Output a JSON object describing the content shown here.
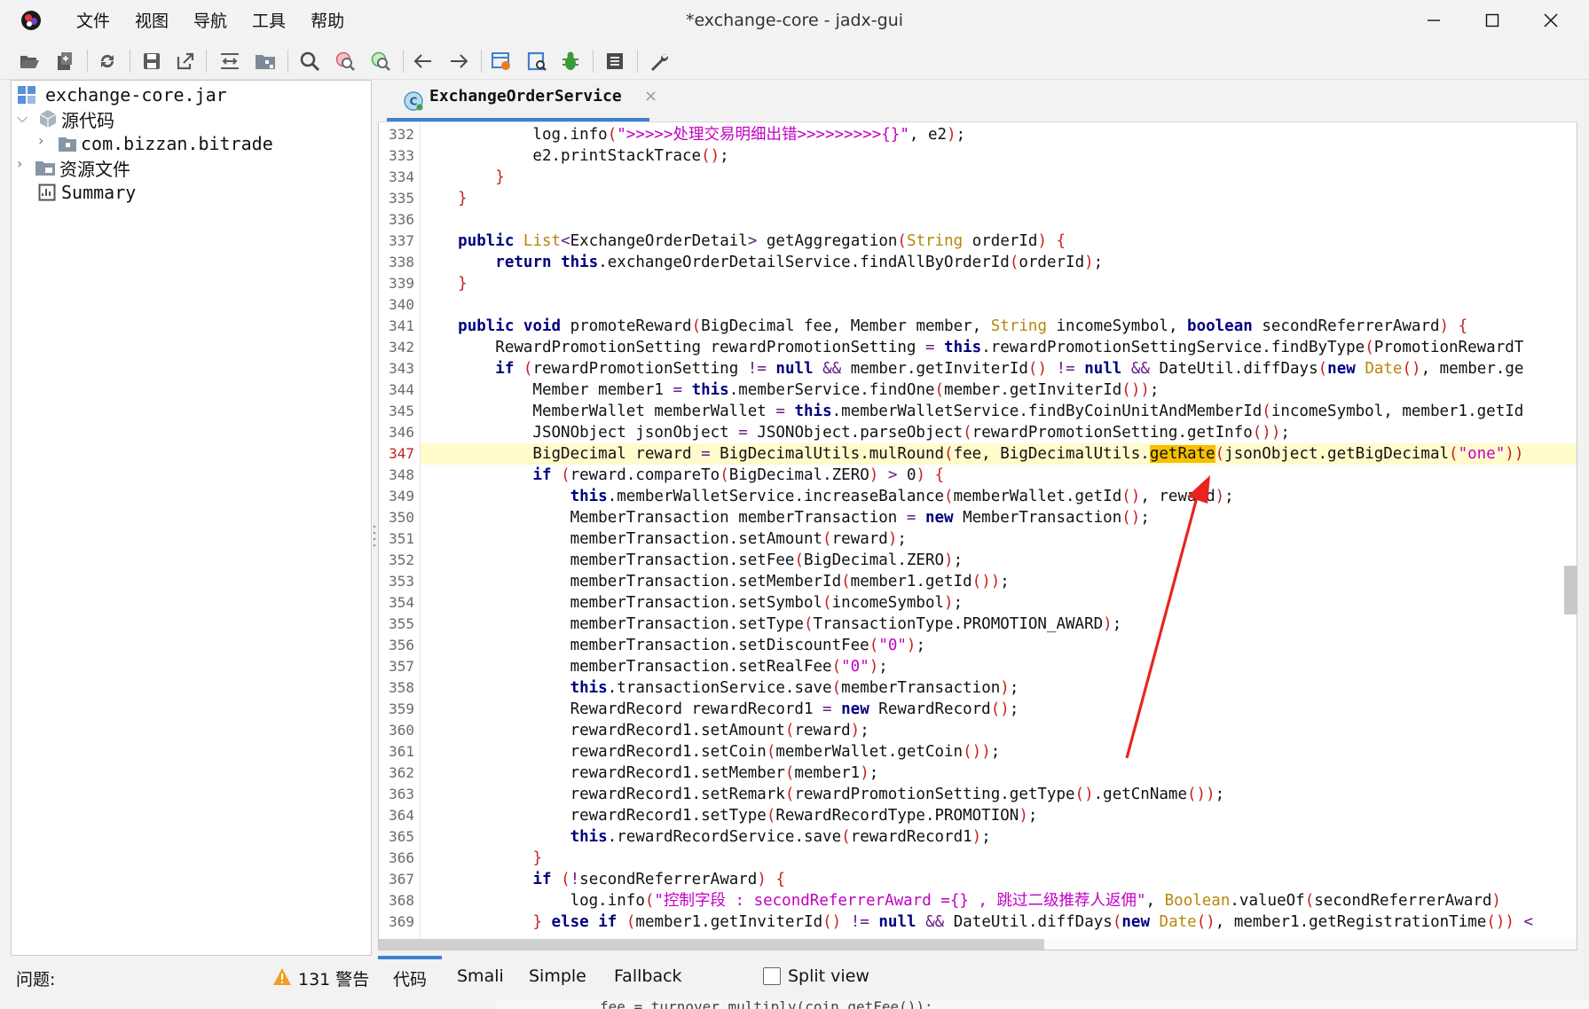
{
  "titlebar": {
    "title": "*exchange-core - jadx-gui",
    "menu": [
      "文件",
      "视图",
      "导航",
      "工具",
      "帮助"
    ]
  },
  "tree": {
    "root": "exchange-core.jar",
    "source_code": "源代码",
    "package": "com.bizzan.bitrade",
    "resources": "资源文件",
    "summary": "Summary"
  },
  "editor": {
    "tab_label": "ExchangeOrderService",
    "tab_close": "×",
    "highlighted_line": 347,
    "highlighted_word": "getRate",
    "lines": [
      {
        "n": 332,
        "t": "            log.info(\">>>>>处理交易明细出错>>>>>>>>>{}\", e2);"
      },
      {
        "n": 333,
        "t": "            e2.printStackTrace();"
      },
      {
        "n": 334,
        "t": "        }"
      },
      {
        "n": 335,
        "t": "    }"
      },
      {
        "n": 336,
        "t": ""
      },
      {
        "n": 337,
        "t": "    public List<ExchangeOrderDetail> getAggregation(String orderId) {"
      },
      {
        "n": 338,
        "t": "        return this.exchangeOrderDetailService.findAllByOrderId(orderId);"
      },
      {
        "n": 339,
        "t": "    }"
      },
      {
        "n": 340,
        "t": ""
      },
      {
        "n": 341,
        "t": "    public void promoteReward(BigDecimal fee, Member member, String incomeSymbol, boolean secondReferrerAward) {"
      },
      {
        "n": 342,
        "t": "        RewardPromotionSetting rewardPromotionSetting = this.rewardPromotionSettingService.findByType(PromotionRewardT"
      },
      {
        "n": 343,
        "t": "        if (rewardPromotionSetting != null && member.getInviterId() != null && DateUtil.diffDays(new Date(), member.ge"
      },
      {
        "n": 344,
        "t": "            Member member1 = this.memberService.findOne(member.getInviterId());"
      },
      {
        "n": 345,
        "t": "            MemberWallet memberWallet = this.memberWalletService.findByCoinUnitAndMemberId(incomeSymbol, member1.getId"
      },
      {
        "n": 346,
        "t": "            JSONObject jsonObject = JSONObject.parseObject(rewardPromotionSetting.getInfo());"
      },
      {
        "n": 347,
        "t": "            BigDecimal reward = BigDecimalUtils.mulRound(fee, BigDecimalUtils.getRate(jsonObject.getBigDecimal(\"one\"))"
      },
      {
        "n": 348,
        "t": "            if (reward.compareTo(BigDecimal.ZERO) > 0) {"
      },
      {
        "n": 349,
        "t": "                this.memberWalletService.increaseBalance(memberWallet.getId(), reward);"
      },
      {
        "n": 350,
        "t": "                MemberTransaction memberTransaction = new MemberTransaction();"
      },
      {
        "n": 351,
        "t": "                memberTransaction.setAmount(reward);"
      },
      {
        "n": 352,
        "t": "                memberTransaction.setFee(BigDecimal.ZERO);"
      },
      {
        "n": 353,
        "t": "                memberTransaction.setMemberId(member1.getId());"
      },
      {
        "n": 354,
        "t": "                memberTransaction.setSymbol(incomeSymbol);"
      },
      {
        "n": 355,
        "t": "                memberTransaction.setType(TransactionType.PROMOTION_AWARD);"
      },
      {
        "n": 356,
        "t": "                memberTransaction.setDiscountFee(\"0\");"
      },
      {
        "n": 357,
        "t": "                memberTransaction.setRealFee(\"0\");"
      },
      {
        "n": 358,
        "t": "                this.transactionService.save(memberTransaction);"
      },
      {
        "n": 359,
        "t": "                RewardRecord rewardRecord1 = new RewardRecord();"
      },
      {
        "n": 360,
        "t": "                rewardRecord1.setAmount(reward);"
      },
      {
        "n": 361,
        "t": "                rewardRecord1.setCoin(memberWallet.getCoin());"
      },
      {
        "n": 362,
        "t": "                rewardRecord1.setMember(member1);"
      },
      {
        "n": 363,
        "t": "                rewardRecord1.setRemark(rewardPromotionSetting.getType().getCnName());"
      },
      {
        "n": 364,
        "t": "                rewardRecord1.setType(RewardRecordType.PROMOTION);"
      },
      {
        "n": 365,
        "t": "                this.rewardRecordService.save(rewardRecord1);"
      },
      {
        "n": 366,
        "t": "            }"
      },
      {
        "n": 367,
        "t": "            if (!secondReferrerAward) {"
      },
      {
        "n": 368,
        "t": "                log.info(\"控制字段 : secondReferrerAward ={} , 跳过二级推荐人返佣\", Boolean.valueOf(secondReferrerAward)"
      },
      {
        "n": 369,
        "t": "            } else if (member1.getInviterId() != null && DateUtil.diffDays(new Date(), member1.getRegistrationTime()) <"
      }
    ]
  },
  "status": {
    "problems": "问题:",
    "warnings": "131 警告",
    "view_tabs": [
      "代码",
      "Smali",
      "Simple",
      "Fallback"
    ],
    "split_view": "Split view",
    "underlay_text": "fee = turnover.multiply(coin.getFee());"
  },
  "colors": {
    "accent": "#3f7fd1",
    "highlight_line": "#fffbcc",
    "highlight_word": "#f6c000",
    "annotation_arrow": "#e8241f"
  }
}
